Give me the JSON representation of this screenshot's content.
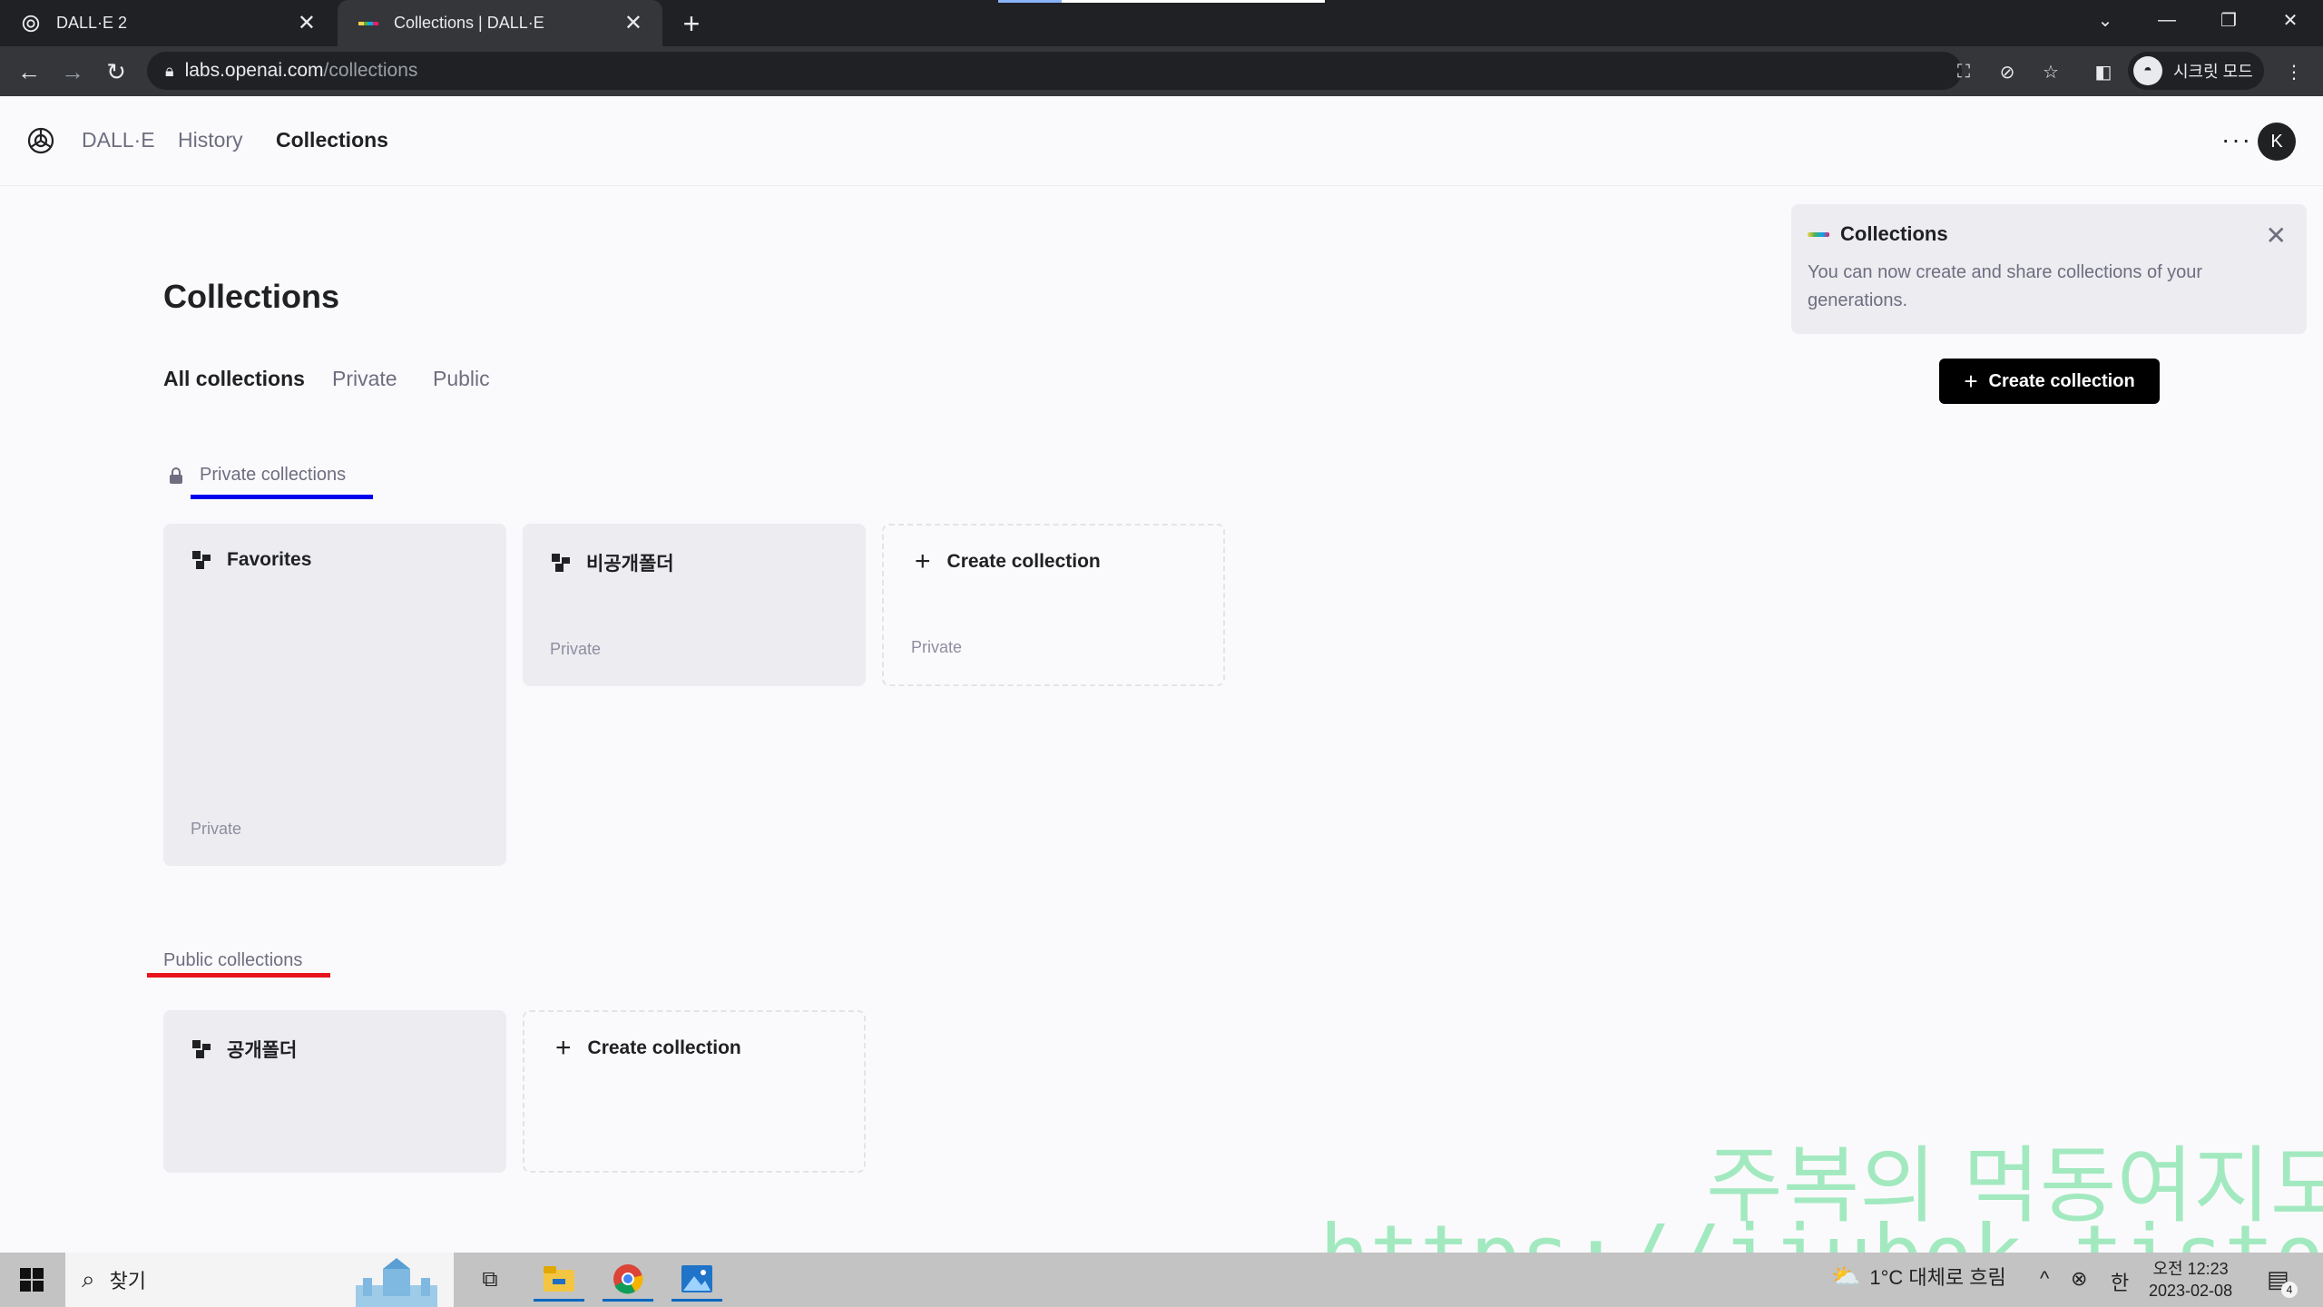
{
  "browser": {
    "tabs": [
      {
        "title": "DALL·E 2",
        "active": false
      },
      {
        "title": "Collections | DALL·E",
        "active": true
      }
    ],
    "url_host": "labs.openai.com",
    "url_path": "/collections",
    "incognito_label": "시크릿 모드"
  },
  "app": {
    "brand": "DALL·E",
    "nav": {
      "history": "History",
      "collections": "Collections"
    },
    "more": "···",
    "avatar": "K"
  },
  "page": {
    "title": "Collections",
    "filter_tabs": {
      "all": "All collections",
      "private": "Private",
      "public": "Public"
    },
    "notice": {
      "title": "Collections",
      "text": "You can now create and share collections of your generations."
    },
    "create_button": "Create collection",
    "private_section": {
      "heading": "Private collections",
      "underline_color": "#0000ee",
      "cards": [
        {
          "title": "Favorites",
          "sub": "Private"
        },
        {
          "title": "비공개폴더",
          "sub": "Private"
        }
      ],
      "create_card": {
        "title": "Create collection",
        "sub": "Private"
      }
    },
    "public_section": {
      "heading": "Public collections",
      "underline_color": "#e8141e",
      "cards": [
        {
          "title": "공개폴더"
        }
      ],
      "create_card": {
        "title": "Create collection"
      }
    }
  },
  "watermark": {
    "line1": "주복의 먹동여지도",
    "line2": "https://jjubok.tistory.com"
  },
  "taskbar": {
    "search_placeholder": "찾기",
    "weather": "1°C 대체로 흐림",
    "ime": "한",
    "time": "오전 12:23",
    "date": "2023-02-08",
    "notifications": "4"
  }
}
